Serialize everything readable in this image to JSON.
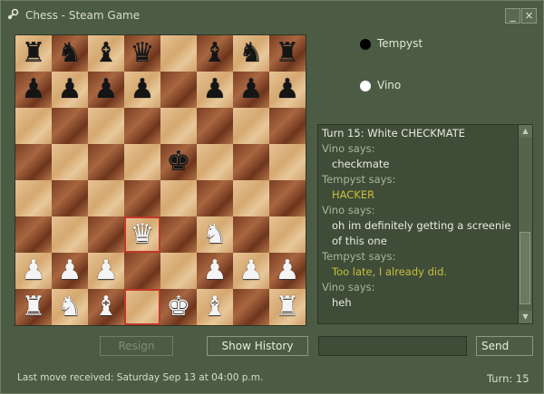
{
  "window": {
    "title": "Chess - Steam Game",
    "minimize_glyph": "_",
    "close_glyph": "×"
  },
  "players": [
    {
      "name": "Tempyst",
      "color": "black"
    },
    {
      "name": "Vino",
      "color": "white"
    }
  ],
  "board": {
    "highlighted": [
      "d3",
      "d1"
    ],
    "pieces": {
      "a8": "bR",
      "b8": "bN",
      "c8": "bB",
      "d8": "bQ",
      "f8": "bB",
      "g8": "bN",
      "h8": "bR",
      "a7": "bP",
      "b7": "bP",
      "c7": "bP",
      "d7": "bP",
      "f7": "bP",
      "g7": "bP",
      "h7": "bP",
      "e5": "bK",
      "d3": "wQ",
      "f3": "wN",
      "a2": "wP",
      "b2": "wP",
      "c2": "wP",
      "f2": "wP",
      "g2": "wP",
      "h2": "wP",
      "a1": "wR",
      "b1": "wN",
      "c1": "wB",
      "e1": "wK",
      "f1": "wB",
      "h1": "wR"
    }
  },
  "chat": {
    "lines": [
      {
        "type": "header",
        "text": "Turn 15: White CHECKMATE"
      },
      {
        "type": "speaker",
        "text": "Vino says:"
      },
      {
        "type": "message",
        "text": "checkmate"
      },
      {
        "type": "speaker",
        "text": "Tempyst says:"
      },
      {
        "type": "highlight",
        "text": "HACKER"
      },
      {
        "type": "speaker",
        "text": "Vino says:"
      },
      {
        "type": "message",
        "text": "oh im definitely getting a screenie"
      },
      {
        "type": "message",
        "text": "of this one"
      },
      {
        "type": "speaker",
        "text": "Tempyst says:"
      },
      {
        "type": "highlight",
        "text": "Too late, I already did."
      },
      {
        "type": "speaker",
        "text": "Vino says:"
      },
      {
        "type": "message",
        "text": "heh"
      }
    ],
    "input_value": "",
    "scroll_up_glyph": "▲",
    "scroll_down_glyph": "▼"
  },
  "buttons": {
    "resign": "Resign",
    "show_history": "Show History",
    "send": "Send"
  },
  "status": {
    "last_move": "Last move received: Saturday Sep 13 at 04:00 p.m.",
    "turn": "Turn: 15"
  }
}
